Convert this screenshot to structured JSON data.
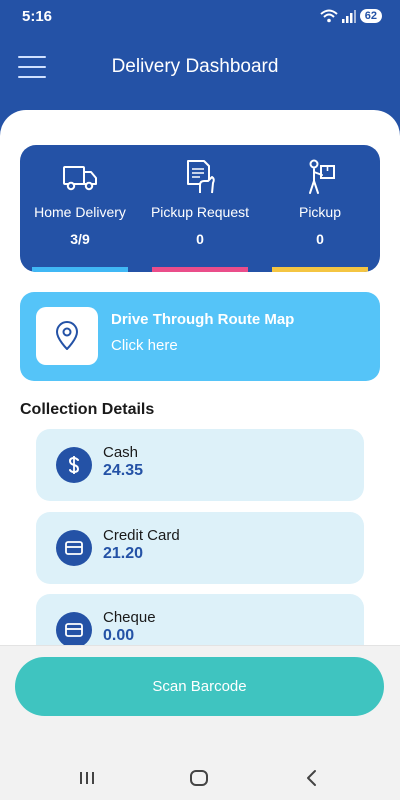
{
  "status_bar": {
    "time": "5:16",
    "battery": "62",
    "icons": [
      "wifi-icon",
      "signal-icon",
      "battery-icon"
    ]
  },
  "header": {
    "title": "Delivery Dashboard",
    "menu_icon": "hamburger-menu-icon"
  },
  "stats": [
    {
      "label": "Home Delivery",
      "value": "3/9",
      "icon": "truck-icon",
      "bar_color": "#40b8f5"
    },
    {
      "label": "Pickup Request",
      "value": "0",
      "icon": "document-hand-icon",
      "bar_color": "#ea4d8a"
    },
    {
      "label": "Pickup",
      "value": "0",
      "icon": "person-carrying-box-icon",
      "bar_color": "#f4c542"
    }
  ],
  "route_card": {
    "title": "Drive Through Route Map",
    "subtitle": "Click here",
    "icon": "map-pin-icon"
  },
  "collection": {
    "title": "Collection Details",
    "items": [
      {
        "label": "Cash",
        "amount": "24.35",
        "icon": "dollar-icon"
      },
      {
        "label": "Credit Card",
        "amount": "21.20",
        "icon": "credit-card-icon"
      },
      {
        "label": "Cheque",
        "amount": "0.00",
        "icon": "cheque-card-icon"
      }
    ]
  },
  "scan_button": {
    "label": "Scan Barcode"
  },
  "nav_bar": {
    "icons": [
      "recent-apps-icon",
      "home-icon",
      "back-icon"
    ]
  },
  "colors": {
    "primary": "#2452a6",
    "route_card": "#55c4f8",
    "scan_button": "#3fc4c0",
    "collection_bg": "#ddf1f9"
  }
}
